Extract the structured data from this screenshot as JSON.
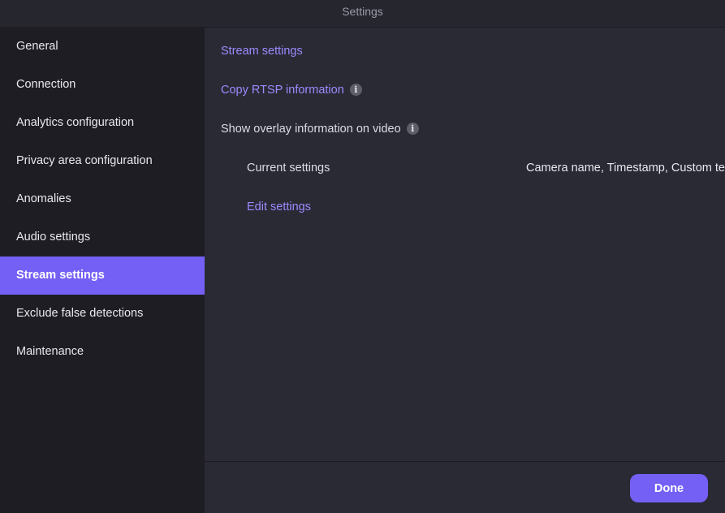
{
  "window": {
    "title": "Settings"
  },
  "sidebar": {
    "items": [
      {
        "label": "General"
      },
      {
        "label": "Connection"
      },
      {
        "label": "Analytics configuration"
      },
      {
        "label": "Privacy area configuration"
      },
      {
        "label": "Anomalies"
      },
      {
        "label": "Audio settings"
      },
      {
        "label": "Stream settings",
        "active": true
      },
      {
        "label": "Exclude false detections"
      },
      {
        "label": "Maintenance"
      }
    ]
  },
  "main": {
    "stream_settings_link": "Stream settings",
    "copy_rtsp_link": "Copy RTSP information",
    "overlay_label": "Show overlay information on video",
    "current_settings_label": "Current settings",
    "current_settings_value": "Camera name, Timestamp, Custom text",
    "edit_settings_link": "Edit settings"
  },
  "footer": {
    "done_label": "Done"
  },
  "colors": {
    "accent": "#7460f5",
    "link": "#9d8aff",
    "sidebar_bg": "#1e1d24",
    "content_bg": "#2a2a35"
  },
  "icons": {
    "info": "info-icon"
  }
}
